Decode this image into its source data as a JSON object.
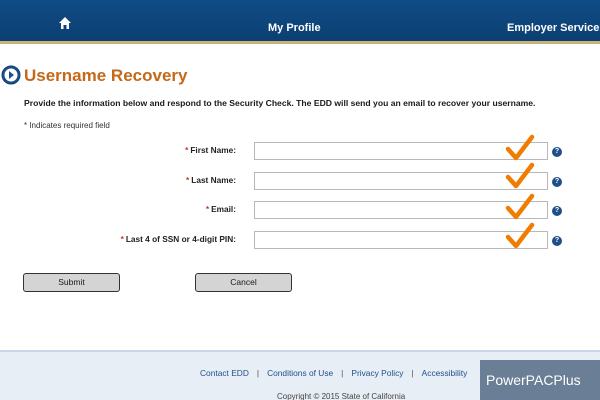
{
  "nav": {
    "home_icon": "home-icon",
    "my_profile": "My Profile",
    "employer_services": "Employer Services"
  },
  "page": {
    "title": "Username Recovery",
    "instructions": "Provide the information below and respond to the Security Check. The EDD will send you an email to recover your username.",
    "required_note": "* Indicates required field"
  },
  "form": {
    "fields": [
      {
        "label": "First Name:",
        "value": "",
        "valid": true
      },
      {
        "label": "Last Name:",
        "value": "",
        "valid": true
      },
      {
        "label": "Email:",
        "value": "",
        "valid": true
      },
      {
        "label": "Last 4 of SSN or 4-digit PIN:",
        "value": "",
        "valid": true
      }
    ],
    "required_marker": "*",
    "help_glyph": "?",
    "submit_label": "Submit",
    "cancel_label": "Cancel"
  },
  "footer": {
    "links": [
      "Contact EDD",
      "Conditions of Use",
      "Privacy Policy",
      "Accessibility"
    ],
    "separator": "|",
    "copyright": "Copyright © 2015 State of California"
  },
  "watermark": "PowerPACPlus",
  "colors": {
    "nav_bg": "#0f4c86",
    "title": "#c4691a",
    "checkmark": "#f07d00",
    "help_icon": "#1f4f8a"
  }
}
